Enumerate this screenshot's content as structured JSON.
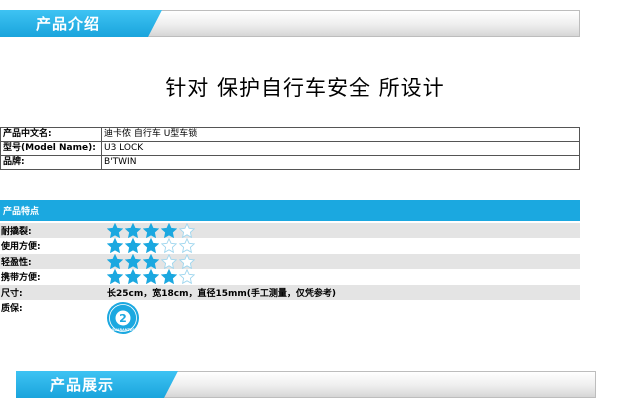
{
  "section_intro": {
    "title": "产品介绍"
  },
  "headline": "针对 保护自行车安全 所设计",
  "info_table": [
    {
      "key": "产品中文名:",
      "value": "迪卡侬 自行车 U型车锁"
    },
    {
      "key": "型号(Model Name):",
      "value": "U3 LOCK"
    },
    {
      "key": "品牌:",
      "value": "B'TWIN"
    }
  ],
  "features": {
    "title": "产品特点",
    "ratings": [
      {
        "label": "耐撬裂:",
        "stars": 4,
        "max": 5
      },
      {
        "label": "使用方便:",
        "stars": 3,
        "max": 5
      },
      {
        "label": "轻盈性:",
        "stars": 3,
        "max": 5
      },
      {
        "label": "携带方便:",
        "stars": 4,
        "max": 5
      }
    ],
    "size": {
      "label": "尺寸:",
      "value": "长25cm，宽18cm，直径15mm(手工测量，仅凭参考)"
    },
    "warranty": {
      "label": "质保:",
      "years": "2",
      "badge_text": "GUARANTEE",
      "icon": "warranty-badge-icon"
    }
  },
  "section_showcase": {
    "title": "产品展示"
  },
  "colors": {
    "accent": "#1ba8e0",
    "star": "#1ba8e0",
    "row_shade": "#e4e4e4"
  }
}
